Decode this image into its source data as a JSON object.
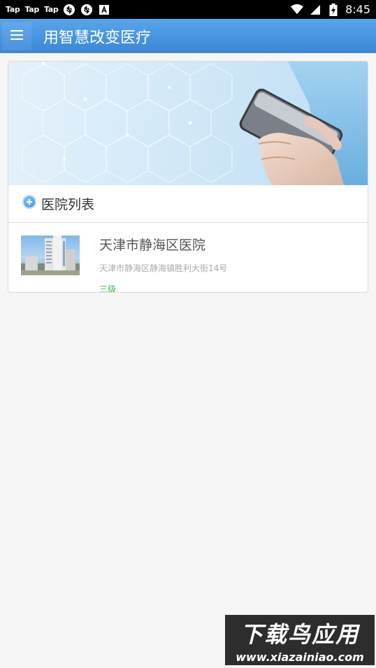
{
  "status_bar": {
    "notifications": [
      "Tap",
      "Tap",
      "Tap"
    ],
    "icons": [
      "sync-icon",
      "sync-icon",
      "a-box-icon",
      "wifi-icon",
      "signal-icon",
      "battery-charging-icon"
    ],
    "time": "8:45"
  },
  "app_bar": {
    "menu_icon": "hamburger-menu-icon",
    "title": "用智慧改变医疗"
  },
  "section": {
    "icon": "plus-circle-icon",
    "title": "医院列表"
  },
  "hospitals": [
    {
      "name": "天津市静海区医院",
      "address": "天津市静海区静海镇胜利大街14号",
      "level": "三级"
    }
  ],
  "colors": {
    "app_bar": "#4a97e2",
    "level_green": "#3cb34a",
    "background": "#f6f6f6"
  },
  "watermark": {
    "title": "下载鸟应用",
    "url": "www.xiazainiao.com"
  }
}
